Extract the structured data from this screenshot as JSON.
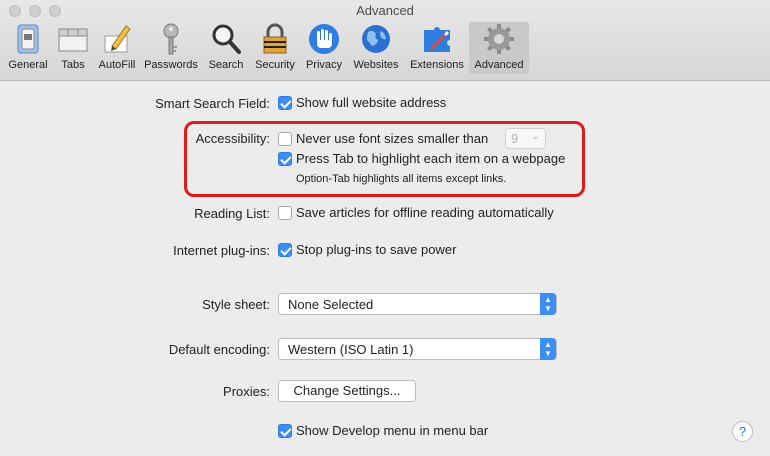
{
  "window": {
    "title": "Advanced"
  },
  "toolbar": {
    "tabs": [
      {
        "label": "General",
        "icon": "general-switch-icon"
      },
      {
        "label": "Tabs",
        "icon": "tabs-icon"
      },
      {
        "label": "AutoFill",
        "icon": "autofill-pencil-icon"
      },
      {
        "label": "Passwords",
        "icon": "key-icon"
      },
      {
        "label": "Search",
        "icon": "magnifier-icon"
      },
      {
        "label": "Security",
        "icon": "lock-icon"
      },
      {
        "label": "Privacy",
        "icon": "hand-icon"
      },
      {
        "label": "Websites",
        "icon": "globe-icon"
      },
      {
        "label": "Extensions",
        "icon": "puzzle-icon"
      },
      {
        "label": "Advanced",
        "icon": "gear-icon"
      }
    ],
    "active": "Advanced"
  },
  "settings": {
    "smart_search": {
      "label": "Smart Search Field:",
      "option": "Show full website address",
      "checked": true
    },
    "accessibility": {
      "label": "Accessibility:",
      "font_option": "Never use font sizes smaller than",
      "font_checked": false,
      "font_size_value": "9",
      "tab_option": "Press Tab to highlight each item on a webpage",
      "tab_checked": true,
      "tab_note": "Option-Tab highlights all items except links."
    },
    "reading_list": {
      "label": "Reading List:",
      "option": "Save articles for offline reading automatically",
      "checked": false
    },
    "plugins": {
      "label": "Internet plug-ins:",
      "option": "Stop plug-ins to save power",
      "checked": true
    },
    "style_sheet": {
      "label": "Style sheet:",
      "value": "None Selected"
    },
    "encoding": {
      "label": "Default encoding:",
      "value": "Western (ISO Latin 1)"
    },
    "proxies": {
      "label": "Proxies:",
      "button": "Change Settings..."
    },
    "develop": {
      "option": "Show Develop menu in menu bar",
      "checked": true
    }
  },
  "help": {
    "label": "?"
  },
  "colors": {
    "accent": "#3a8ef6",
    "highlight_box": "#e01b1b"
  }
}
